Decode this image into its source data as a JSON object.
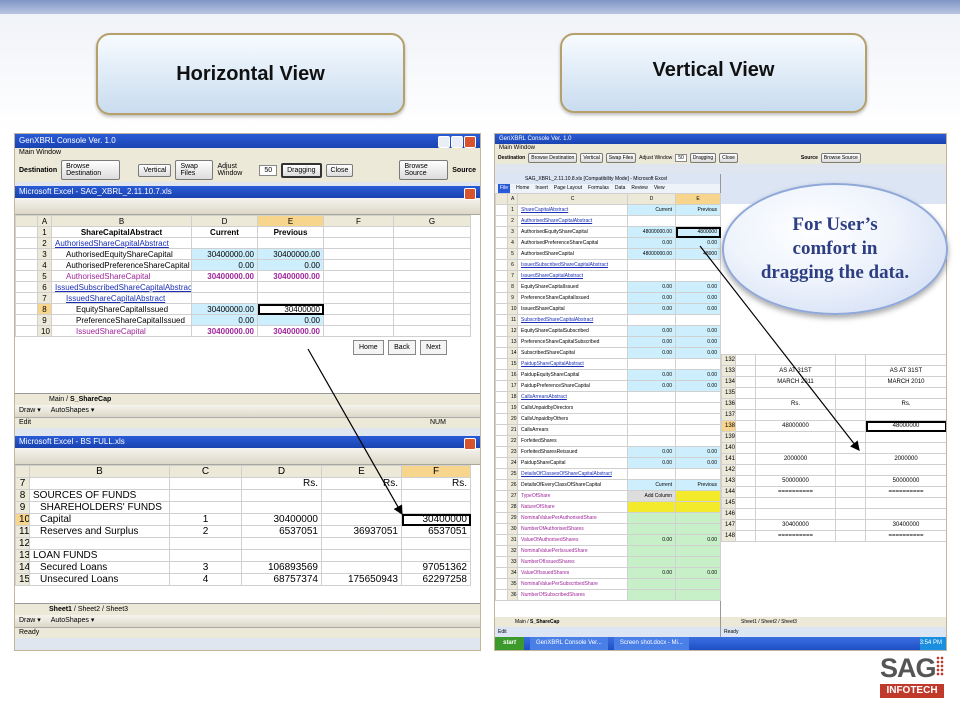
{
  "slide": {
    "horizontal_label": "Horizontal View",
    "vertical_label": "Vertical View",
    "callout": "For User’s comfort in dragging the data.",
    "logo_main": "SAG",
    "logo_sub": "INFOTECH"
  },
  "left_window": {
    "title": "GenXBRL Console Ver. 1.0",
    "menu": "Main Window",
    "destination_label": "Destination",
    "source_label": "Source",
    "buttons": [
      "Browse Destination",
      "Vertical",
      "Swap Files",
      "Adjust Window",
      "Dragging",
      "Close",
      "Browse Source"
    ],
    "adjust_value": "50",
    "top_excel_title": "Microsoft Excel - SAG_XBRL_2.11.10.7.xls",
    "top_cols": [
      "A",
      "B",
      "C",
      "D",
      "E",
      "F",
      "G"
    ],
    "top_rows": [
      {
        "n": "1",
        "label": "ShareCapitalAbstract",
        "d": "Current",
        "e": "Previous"
      },
      {
        "n": "2",
        "label": "AuthorisedShareCapitalAbstract",
        "d": "",
        "e": ""
      },
      {
        "n": "3",
        "label": "AuthorisedEquityShareCapital",
        "d": "30400000.00",
        "e": "30400000.00"
      },
      {
        "n": "4",
        "label": "AuthorisedPreferenceShareCapital",
        "d": "0.00",
        "e": "0.00"
      },
      {
        "n": "5",
        "label": "AuthorisedShareCapital",
        "d": "30400000.00",
        "e": "30400000.00"
      },
      {
        "n": "6",
        "label": "IssuedSubscribedShareCapitalAbstract",
        "d": "",
        "e": ""
      },
      {
        "n": "7",
        "label": "IssuedShareCapitalAbstract",
        "d": "",
        "e": ""
      },
      {
        "n": "8",
        "label": "EquityShareCapitalIssued",
        "d": "30400000.00",
        "e": "30400000"
      },
      {
        "n": "9",
        "label": "PreferenceShareCapitalIssued",
        "d": "0.00",
        "e": "0.00"
      },
      {
        "n": "10",
        "label": "IssuedShareCapital",
        "d": "30400000.00",
        "e": "30400000.00"
      }
    ],
    "nav_buttons": [
      "Home",
      "Back",
      "Next"
    ],
    "top_tabs": [
      "Main",
      "S_ShareCap"
    ],
    "draw_label": "Draw ▾",
    "autoshapes_label": "AutoShapes ▾",
    "edit_status": "Edit",
    "num_status": "NUM",
    "bottom_excel_title": "Microsoft Excel - BS FULL.xls",
    "bottom_cols": [
      "B",
      "C",
      "D",
      "E",
      "F"
    ],
    "bottom_rows": [
      {
        "n": "7",
        "b": "",
        "c": "",
        "d": "Rs.",
        "e": "Rs.",
        "f": "Rs."
      },
      {
        "n": "8",
        "b": "SOURCES OF FUNDS",
        "c": "",
        "d": "",
        "e": "",
        "f": ""
      },
      {
        "n": "9",
        "b": "SHAREHOLDERS' FUNDS",
        "c": "",
        "d": "",
        "e": "",
        "f": ""
      },
      {
        "n": "10",
        "b": "Capital",
        "c": "1",
        "d": "30400000",
        "e": "",
        "f": "30400000"
      },
      {
        "n": "11",
        "b": "Reserves and Surplus",
        "c": "2",
        "d": "6537051",
        "e": "36937051",
        "f": "6537051"
      },
      {
        "n": "12",
        "b": "",
        "c": "",
        "d": "",
        "e": "",
        "f": ""
      },
      {
        "n": "13",
        "b": "LOAN FUNDS",
        "c": "",
        "d": "",
        "e": "",
        "f": ""
      },
      {
        "n": "14",
        "b": "Secured Loans",
        "c": "3",
        "d": "106893569",
        "e": "",
        "f": "97051362"
      },
      {
        "n": "15",
        "b": "Unsecured Loans",
        "c": "4",
        "d": "68757374",
        "e": "175650943",
        "f": "62297258"
      }
    ],
    "bottom_tabs": [
      "Sheet1",
      "Sheet2",
      "Sheet3"
    ],
    "ready_status": "Ready"
  },
  "right_window": {
    "title": "GenXBRL Console Ver. 1.0",
    "menu": "Main Window",
    "buttons": [
      "Browse Destination",
      "Vertical",
      "Swap Files",
      "Adjust Window",
      "Dragging",
      "Close",
      "Browse Source"
    ],
    "adjust_value": "50",
    "destination_label": "Destination",
    "source_label": "Source",
    "excel_title": "SAG_XBRL_2.11.10.8.xls [Compatibility Mode] - Microsoft Excel",
    "ribbon_tabs": [
      "File",
      "Home",
      "Insert",
      "Page Layout",
      "Formulas",
      "Data",
      "Review",
      "View"
    ],
    "cols": [
      "A",
      "B",
      "C",
      "D",
      "E"
    ],
    "rows": [
      {
        "n": "1",
        "label": "ShareCapitalAbstract",
        "d": "Current",
        "e": "Previous"
      },
      {
        "n": "2",
        "label": "AuthorisedShareCapitalAbstract",
        "d": "",
        "e": ""
      },
      {
        "n": "3",
        "label": "AuthorisedEquityShareCapital",
        "d": "48000000.00",
        "e": "4800000"
      },
      {
        "n": "4",
        "label": "AuthorisedPreferenceShareCapital",
        "d": "0.00",
        "e": "0.00"
      },
      {
        "n": "5",
        "label": "AuthorisedShareCapital",
        "d": "48000000.00",
        "e": "48000"
      },
      {
        "n": "6",
        "label": "IssuedSubscribedShareCapitalAbstract",
        "d": "",
        "e": ""
      },
      {
        "n": "7",
        "label": "IssuedShareCapitalAbstract",
        "d": "",
        "e": ""
      },
      {
        "n": "8",
        "label": "EquityShareCapitalIssued",
        "d": "0.00",
        "e": "0.00"
      },
      {
        "n": "9",
        "label": "PreferenceShareCapitalIssued",
        "d": "0.00",
        "e": "0.00"
      },
      {
        "n": "10",
        "label": "IssuedShareCapital",
        "d": "0.00",
        "e": "0.00"
      },
      {
        "n": "11",
        "label": "SubscribedShareCapitalAbstract",
        "d": "",
        "e": ""
      },
      {
        "n": "12",
        "label": "EquityShareCapitalSubscribed",
        "d": "0.00",
        "e": "0.00"
      },
      {
        "n": "13",
        "label": "PreferenceShareCapitalSubscribed",
        "d": "0.00",
        "e": "0.00"
      },
      {
        "n": "14",
        "label": "SubscribedShareCapital",
        "d": "0.00",
        "e": "0.00"
      },
      {
        "n": "15",
        "label": "PaidupShareCapitalAbstract",
        "d": "",
        "e": ""
      },
      {
        "n": "16",
        "label": "PaidupEquityShareCapital",
        "d": "0.00",
        "e": "0.00"
      },
      {
        "n": "17",
        "label": "PaidupPreferenceShareCapital",
        "d": "0.00",
        "e": "0.00"
      },
      {
        "n": "18",
        "label": "CallsArrearsAbstract",
        "d": "",
        "e": ""
      },
      {
        "n": "19",
        "label": "CallsUnpaidbyDirectors",
        "d": "",
        "e": ""
      },
      {
        "n": "20",
        "label": "CallsUnpaidbyOthers",
        "d": "",
        "e": ""
      },
      {
        "n": "21",
        "label": "CallsArrears",
        "d": "",
        "e": ""
      },
      {
        "n": "22",
        "label": "ForfeitedShares",
        "d": "",
        "e": ""
      },
      {
        "n": "23",
        "label": "ForfeitedSharesReissued",
        "d": "0.00",
        "e": "0.00"
      },
      {
        "n": "24",
        "label": "PaidupShareCapital",
        "d": "0.00",
        "e": "0.00"
      },
      {
        "n": "25",
        "label": "DetailsOfClassesOfShareCapitalAbstract",
        "d": "",
        "e": ""
      },
      {
        "n": "26",
        "label": "DetailsOfEveryClassOfShareCapital",
        "d": "Current",
        "e": "Previous"
      },
      {
        "n": "27",
        "label": "TypeOfShare",
        "d": "Add Column",
        "e": ""
      },
      {
        "n": "28",
        "label": "NatureOfShare",
        "d": "",
        "e": ""
      },
      {
        "n": "29",
        "label": "NominalValuePerAuthorisedShare",
        "d": "",
        "e": ""
      },
      {
        "n": "30",
        "label": "NumberOfAuthorisedShares",
        "d": "",
        "e": ""
      },
      {
        "n": "31",
        "label": "ValueOfAuthorisedShares",
        "d": "0.00",
        "e": "0.00"
      },
      {
        "n": "32",
        "label": "NominalValuePerIssuedShare",
        "d": "",
        "e": ""
      },
      {
        "n": "33",
        "label": "NumberOfIssuedShares",
        "d": "",
        "e": ""
      },
      {
        "n": "34",
        "label": "ValueOfIssuedShares",
        "d": "0.00",
        "e": "0.00"
      },
      {
        "n": "35",
        "label": "NominalValuePerSubscribedShare",
        "d": "",
        "e": ""
      },
      {
        "n": "36",
        "label": "NumberOfSubscribedShares",
        "d": "",
        "e": ""
      }
    ],
    "tabs": [
      "Main",
      "S_ShareCap"
    ],
    "edit_status": "Edit",
    "second_rows": [
      {
        "n": "132",
        "a": "",
        "b": ""
      },
      {
        "n": "133",
        "a": "AS AT 31ST",
        "b": "AS AT 31ST"
      },
      {
        "n": "134",
        "a": "MARCH 2011",
        "b": "MARCH 2010"
      },
      {
        "n": "135",
        "a": "",
        "b": ""
      },
      {
        "n": "136",
        "a": "Rs.",
        "b": "Rs."
      },
      {
        "n": "137",
        "a": "",
        "b": ""
      },
      {
        "n": "138",
        "a": "48000000",
        "b": "48000000"
      },
      {
        "n": "139",
        "a": "",
        "b": ""
      },
      {
        "n": "140",
        "a": "",
        "b": ""
      },
      {
        "n": "141",
        "a": "2000000",
        "b": "2000000"
      },
      {
        "n": "142",
        "a": "",
        "b": ""
      },
      {
        "n": "143",
        "a": "50000000",
        "b": "50000000"
      },
      {
        "n": "144",
        "a": "==========",
        "b": "=========="
      },
      {
        "n": "145",
        "a": "",
        "b": ""
      },
      {
        "n": "146",
        "a": "",
        "b": ""
      },
      {
        "n": "147",
        "a": "30400000",
        "b": "30400000"
      },
      {
        "n": "148",
        "a": "==========",
        "b": "=========="
      }
    ],
    "second_tabs": [
      "Sheet1",
      "Sheet2",
      "Sheet3"
    ],
    "ready_status": "Ready",
    "taskbar_start": "start",
    "taskbar_items": [
      "GenXBRL Console Ver...",
      "Screen shot.docx - Mi..."
    ],
    "clock": "3:54 PM"
  }
}
